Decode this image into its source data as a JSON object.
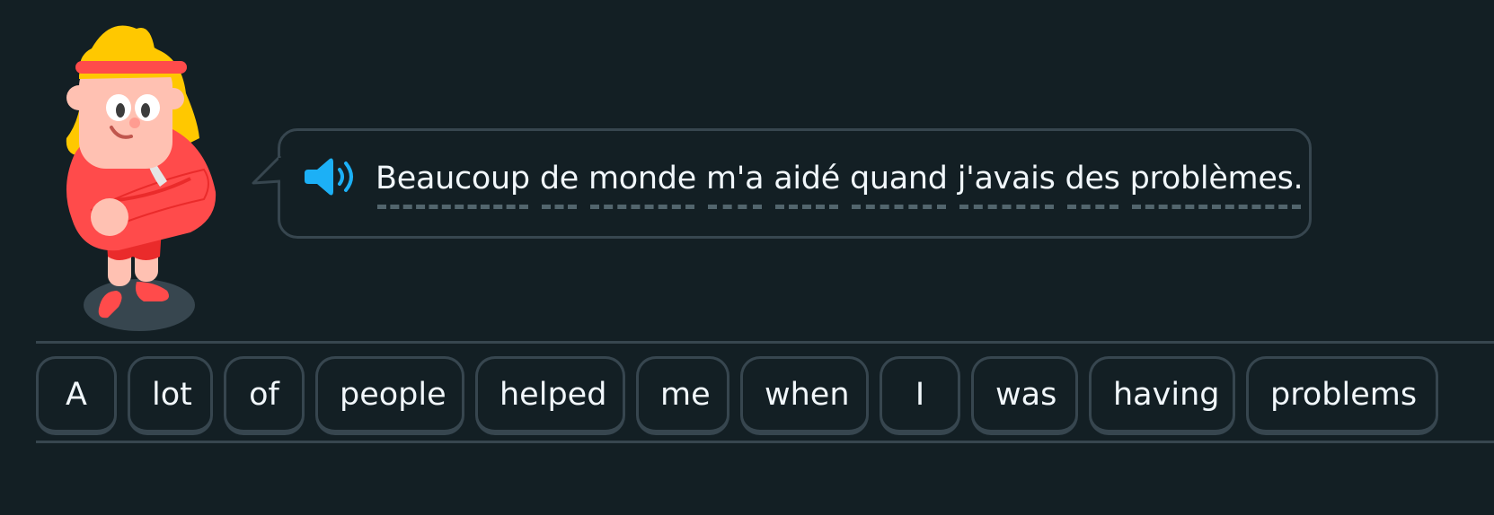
{
  "prompt": {
    "speaker_icon": "speaker-icon",
    "sentence_words": [
      "Beaucoup",
      "de",
      "monde",
      "m'a",
      "aidé",
      "quand",
      "j'avais",
      "des",
      "problèmes."
    ]
  },
  "word_bank": {
    "tiles": [
      "A",
      "lot",
      "of",
      "people",
      "helped",
      "me",
      "when",
      "I",
      "was",
      "having",
      "problems"
    ]
  },
  "colors": {
    "background": "#131f24",
    "border": "#37464f",
    "text": "#f1f7fb",
    "speaker": "#1cb0f6",
    "character_shirt": "#ff4b4b",
    "character_hair": "#ffc800"
  }
}
